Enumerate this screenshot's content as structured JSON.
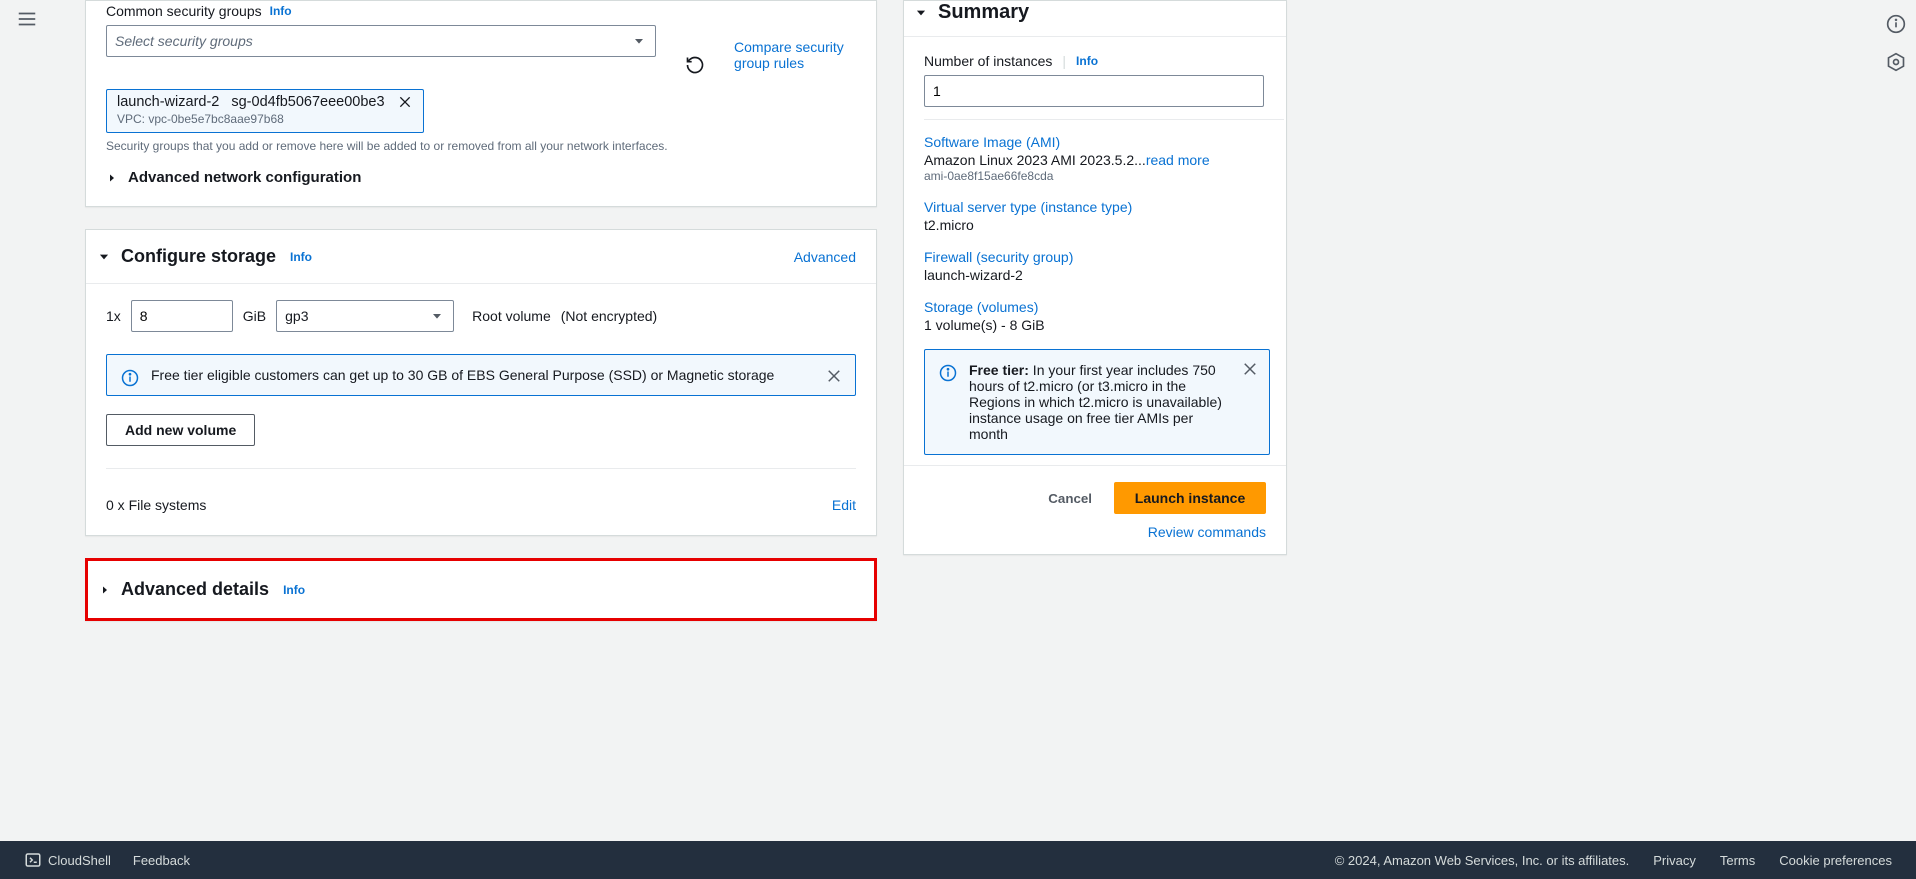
{
  "security": {
    "heading": "Common security groups",
    "info": "Info",
    "select_placeholder": "Select security groups",
    "compare_link": "Compare security group rules",
    "chip_name": "launch-wizard-2",
    "chip_id": "sg-0d4fb5067eee00be3",
    "chip_vpc": "VPC: vpc-0be5e7bc8aae97b68",
    "helper": "Security groups that you add or remove here will be added to or removed from all your network interfaces.",
    "advanced_net": "Advanced network configuration"
  },
  "storage": {
    "heading": "Configure storage",
    "info": "Info",
    "advanced": "Advanced",
    "count": "1x",
    "size": "8",
    "unit": "GiB",
    "type": "gp3",
    "root_label": "Root volume",
    "enc_label": "(Not encrypted)",
    "free_tier_msg": "Free tier eligible customers can get up to 30 GB of EBS General Purpose (SSD) or Magnetic storage",
    "add_btn": "Add new volume",
    "fs_label": "0 x File systems",
    "edit": "Edit"
  },
  "advanced_details": {
    "heading": "Advanced details",
    "info": "Info"
  },
  "summary": {
    "heading": "Summary",
    "num_instances_label": "Number of instances",
    "info": "Info",
    "num_instances_value": "1",
    "ami_label": "Software Image (AMI)",
    "ami_line": "Amazon Linux 2023 AMI 2023.5.2...",
    "ami_read_more": "read more",
    "ami_id": "ami-0ae8f15ae66fe8cda",
    "inst_type_label": "Virtual server type (instance type)",
    "inst_type_value": "t2.micro",
    "firewall_label": "Firewall (security group)",
    "firewall_value": "launch-wizard-2",
    "storage_label": "Storage (volumes)",
    "storage_value": "1 volume(s) - 8 GiB",
    "free_tier_label": "Free tier:",
    "free_tier_text": " In your first year includes 750 hours of t2.micro (or t3.micro in the Regions in which t2.micro is unavailable) instance usage on free tier AMIs per month",
    "cancel": "Cancel",
    "launch": "Launch instance",
    "review": "Review commands"
  },
  "footer": {
    "cloudshell": "CloudShell",
    "feedback": "Feedback",
    "copyright": "© 2024, Amazon Web Services, Inc. or its affiliates.",
    "privacy": "Privacy",
    "terms": "Terms",
    "cookies": "Cookie preferences"
  }
}
